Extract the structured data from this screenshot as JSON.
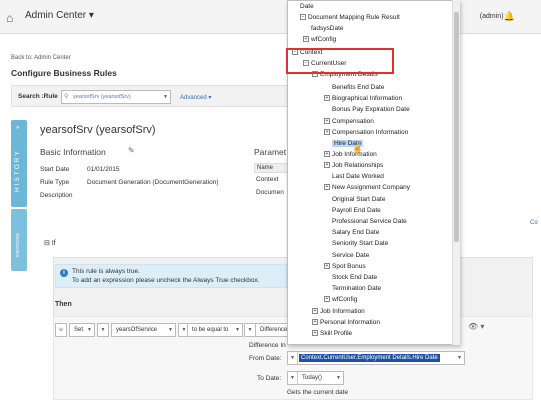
{
  "header": {
    "app_title": "Admin Center",
    "user": "(admin)"
  },
  "nav": {
    "back": "Back to: Admin Center"
  },
  "page": {
    "title": "Configure Business Rules"
  },
  "search": {
    "label": "Search :Rule",
    "value": "yearsofSrv (yearsofSrv)",
    "advanced": "Advanced"
  },
  "side": {
    "history": "HISTORY",
    "second": "IDEATIONS"
  },
  "rule": {
    "title": "yearsofSrv (yearsofSrv)",
    "basic_info": "Basic Information",
    "parameters": "Paramet",
    "fields": [
      {
        "label": "Start Date",
        "value": "01/01/2015"
      },
      {
        "label": "Rule Type",
        "value": "Document Generation (DocumentGeneration)"
      },
      {
        "label": "Description",
        "value": ""
      }
    ],
    "param_header": "Name",
    "param_rows": [
      "Context",
      "Documen"
    ],
    "co_link": "Co"
  },
  "if": {
    "label": "If",
    "info1": "This rule is always true.",
    "info2": "To add an expression please uncheck the Always True checkbox."
  },
  "then": {
    "label": "Then",
    "set": "Set",
    "target": "yearsOfService",
    "op": "to be equal to",
    "func": "Difference",
    "diff_label": "Difference In",
    "from_label": "From Date:",
    "from_value": "Context.CurrentUser.Employment Details.Hire Date",
    "to_label": "To Date:",
    "to_value": "Today()",
    "gets": "Gets the current date"
  },
  "tree": {
    "items": [
      {
        "label": "Date",
        "exp": ""
      },
      {
        "label": "Document Mapping Rule Result",
        "exp": "minus"
      },
      {
        "label": "fadsysDate",
        "exp": ""
      },
      {
        "label": "wfConfig",
        "exp": "plus"
      },
      {
        "label": "Context",
        "exp": "minus"
      },
      {
        "label": "CurrentUser",
        "exp": "minus"
      },
      {
        "label": "Employment Details",
        "exp": "minus"
      },
      {
        "label": "Benefits End Date",
        "exp": ""
      },
      {
        "label": "Biographical Information",
        "exp": "plus"
      },
      {
        "label": "Bonus Pay Expiration Date",
        "exp": ""
      },
      {
        "label": "Compensation",
        "exp": "plus"
      },
      {
        "label": "Compensation Information",
        "exp": "plus"
      },
      {
        "label": "Hire Date",
        "exp": ""
      },
      {
        "label": "Job Information",
        "exp": "plus"
      },
      {
        "label": "Job Relationships",
        "exp": "plus"
      },
      {
        "label": "Last Date Worked",
        "exp": ""
      },
      {
        "label": "New Assignment Company",
        "exp": "plus"
      },
      {
        "label": "Original Start Date",
        "exp": ""
      },
      {
        "label": "Payroll End Date",
        "exp": ""
      },
      {
        "label": "Professional Service Date",
        "exp": ""
      },
      {
        "label": "Salary End Date",
        "exp": ""
      },
      {
        "label": "Seniority Start Date",
        "exp": ""
      },
      {
        "label": "Service Date",
        "exp": ""
      },
      {
        "label": "Spot Bonus",
        "exp": "plus"
      },
      {
        "label": "Stock End Date",
        "exp": ""
      },
      {
        "label": "Termination Date",
        "exp": ""
      },
      {
        "label": "wfConfig",
        "exp": "plus"
      },
      {
        "label": "Job Information",
        "exp": "plus"
      },
      {
        "label": "Personal Information",
        "exp": "plus"
      },
      {
        "label": "Skill Profile",
        "exp": "plus"
      }
    ]
  },
  "colors": {
    "accent": "#6ab7d8",
    "selection": "#1f4fa8",
    "highlight": "#bcd7f5",
    "annotation": "#e03030"
  }
}
